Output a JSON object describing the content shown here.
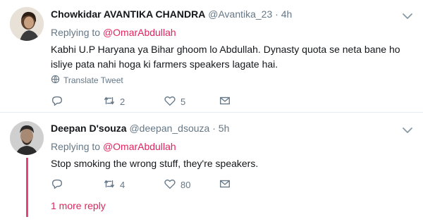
{
  "tweets": [
    {
      "name": "Chowkidar AVANTIKA CHANDRA",
      "handle": "@Avantika_23",
      "dot": "·",
      "time": "4h",
      "replying_prefix": "Replying to",
      "replying_to": "@OmarAbdullah",
      "text": "Kabhi U.P Haryana ya Bihar ghoom lo Abdullah. Dynasty quota se neta bane ho isliye pata nahi hoga ki farmers speakers lagate hai.",
      "translate": "Translate Tweet",
      "reply_count": "",
      "retweet_count": "2",
      "like_count": "5"
    },
    {
      "name": "Deepan D'souza",
      "handle": "@deepan_dsouza",
      "dot": "·",
      "time": "5h",
      "replying_prefix": "Replying to",
      "replying_to": "@OmarAbdullah",
      "text": "Stop smoking the wrong stuff, they're speakers.",
      "reply_count": "",
      "retweet_count": "4",
      "like_count": "80"
    }
  ],
  "more_replies": "1 more reply",
  "colors": {
    "accent": "#e0245e",
    "muted": "#657786",
    "text": "#14171a",
    "divider": "#e6ecf0"
  },
  "icons": [
    "reply-icon",
    "retweet-icon",
    "like-icon",
    "direct-message-icon",
    "chevron-down-icon",
    "globe-icon"
  ]
}
